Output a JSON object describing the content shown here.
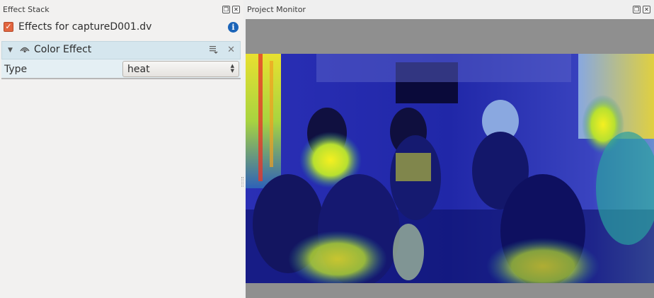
{
  "effect_stack": {
    "title": "Effect Stack",
    "clip": {
      "enabled": true,
      "label": "Effects for captureD001.dv"
    },
    "effects": [
      {
        "name": "Color Effect",
        "params": [
          {
            "label": "Type",
            "value": "heat"
          }
        ]
      }
    ]
  },
  "monitor": {
    "title": "Project Monitor"
  },
  "icons": {
    "float": "float-icon",
    "close": "close-icon",
    "info": "info-icon",
    "collapse": "collapse-arrow-icon",
    "eye": "eye-icon",
    "menu": "effect-menu-icon"
  },
  "colors": {
    "accent_check": "#e2653f",
    "effect_header_bg": "#d5e6ee",
    "monitor_bg": "#8f8f8f",
    "info_blue": "#1b64b8"
  }
}
